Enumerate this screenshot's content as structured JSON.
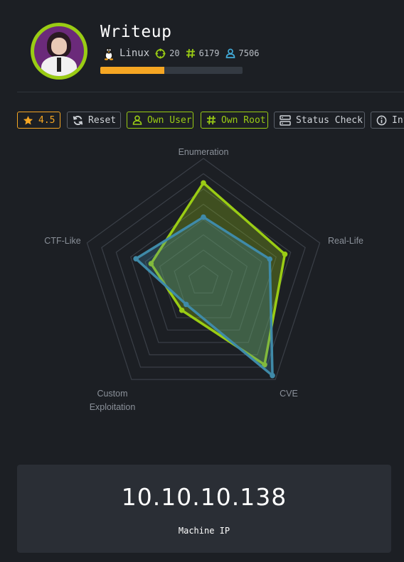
{
  "machine": {
    "name": "Writeup",
    "os": "Linux",
    "points": "20",
    "root_owns": "6179",
    "user_owns": "7506",
    "progress_fraction": 0.45
  },
  "toolbar": {
    "rating": "4.5",
    "reset": "Reset",
    "own_user": "Own User",
    "own_root": "Own Root",
    "status_check": "Status Check",
    "info": "Info"
  },
  "chart_data": {
    "type": "radar",
    "axes": [
      "Enumeration",
      "Real-Life",
      "CVE",
      "Custom Exploitation",
      "CTF-Like"
    ],
    "axis_label_lines": [
      [
        "Enumeration"
      ],
      [
        "Real-Life"
      ],
      [
        "CVE"
      ],
      [
        "Custom",
        "Exploitation"
      ],
      [
        "CTF-Like"
      ]
    ],
    "max": 10,
    "rings": 8,
    "series": [
      {
        "color": "#9acc14",
        "values": [
          8,
          7,
          8.5,
          3,
          4.5
        ]
      },
      {
        "color": "#3f8aa8",
        "values": [
          5.2,
          5.7,
          9.6,
          2.4,
          5.8
        ]
      }
    ]
  },
  "ip_panel": {
    "ip": "10.10.10.138",
    "label": "Machine IP"
  },
  "colors": {
    "accent_green": "#9acc14",
    "accent_orange": "#f5a623",
    "accent_blue": "#3f8aa8",
    "background": "#1c1f24"
  }
}
